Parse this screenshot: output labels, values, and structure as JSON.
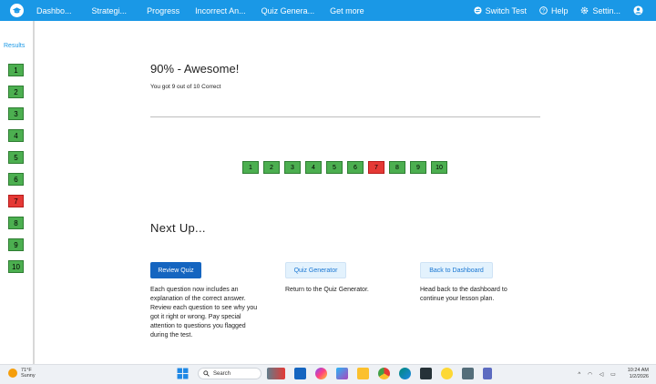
{
  "nav": {
    "items": [
      "Dashbo...",
      "Strategi...",
      "Progress",
      "Incorrect An...",
      "Quiz Genera...",
      "Get more"
    ],
    "switch_test": "Switch Test",
    "help": "Help",
    "settings": "Settin..."
  },
  "sidebar": {
    "title": "Results",
    "items": [
      {
        "label": "1",
        "correct": true
      },
      {
        "label": "2",
        "correct": true
      },
      {
        "label": "3",
        "correct": true
      },
      {
        "label": "4",
        "correct": true
      },
      {
        "label": "5",
        "correct": true
      },
      {
        "label": "6",
        "correct": true
      },
      {
        "label": "7",
        "correct": false
      },
      {
        "label": "8",
        "correct": true
      },
      {
        "label": "9",
        "correct": true
      },
      {
        "label": "10",
        "correct": true
      }
    ]
  },
  "result": {
    "title": "90% - Awesome!",
    "subtitle": "You got 9 out of 10 Correct"
  },
  "questions": [
    "1",
    "2",
    "3",
    "4",
    "5",
    "6",
    "7",
    "8",
    "9",
    "10"
  ],
  "next": {
    "heading": "Next Up...",
    "review_label": "Review Quiz",
    "review_desc": "Each question now includes an explanation of the correct answer. Review each question to see why you got it right or wrong. Pay special attention to questions you flagged during the test.",
    "generator_label": "Quiz Generator",
    "generator_desc": "Return to the Quiz Generator.",
    "dashboard_label": "Back to Dashboard",
    "dashboard_desc": "Head back to the dashboard to continue your lesson plan."
  },
  "taskbar": {
    "temp": "71°F",
    "weather": "Sunny",
    "search_placeholder": "Search",
    "time": "10:24 AM",
    "date": "1/2/2026"
  },
  "colors": {
    "accent": "#1a98e6",
    "correct": "#4caf50",
    "wrong": "#e53935",
    "primary_button": "#1565c0"
  }
}
